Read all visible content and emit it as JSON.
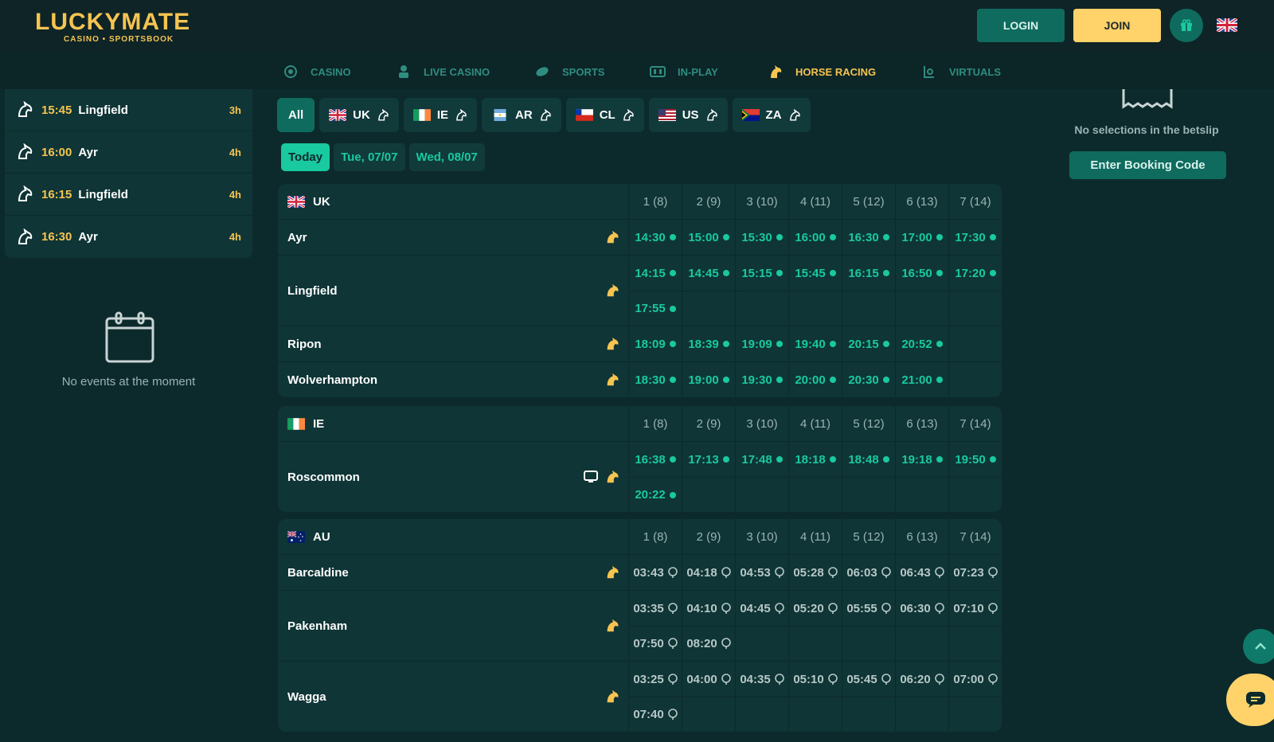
{
  "brand": {
    "name_part1": "LUCKY",
    "name_part2": "MATE",
    "tagline": "CASINO • SPORTSBOOK"
  },
  "header": {
    "login_label": "LOGIN",
    "join_label": "JOIN",
    "gift_icon": "gift-icon",
    "language_flag": "UK"
  },
  "nav": {
    "items": [
      {
        "label": "CASINO",
        "icon": "casino-chip-icon"
      },
      {
        "label": "LIVE CASINO",
        "icon": "dealer-icon"
      },
      {
        "label": "SPORTS",
        "icon": "ball-icon"
      },
      {
        "label": "IN-PLAY",
        "icon": "scoreboard-icon"
      },
      {
        "label": "HORSE RACING",
        "icon": "horse-icon",
        "active": true
      },
      {
        "label": "VIRTUALS",
        "icon": "virtuals-icon"
      }
    ]
  },
  "upcoming": [
    {
      "time": "15:45",
      "track": "Lingfield",
      "eta": "3h"
    },
    {
      "time": "16:00",
      "track": "Ayr",
      "eta": "4h"
    },
    {
      "time": "16:15",
      "track": "Lingfield",
      "eta": "4h"
    },
    {
      "time": "16:30",
      "track": "Ayr",
      "eta": "4h"
    }
  ],
  "no_events": "No events at the moment",
  "country_filters": {
    "all": "All",
    "countries": [
      "UK",
      "IE",
      "AR",
      "CL",
      "US",
      "ZA"
    ]
  },
  "date_filters": [
    "Today",
    "Tue, 07/07",
    "Wed, 08/07"
  ],
  "columns": [
    "1 (8)",
    "2 (9)",
    "3 (10)",
    "4 (11)",
    "5 (12)",
    "6 (13)",
    "7 (14)"
  ],
  "sections": {
    "uk": {
      "country": "UK",
      "meetings": [
        {
          "track": "Ayr",
          "races": [
            "14:30",
            "15:00",
            "15:30",
            "16:00",
            "16:30",
            "17:00",
            "17:30"
          ]
        },
        {
          "track": "Lingfield",
          "races": [
            "14:15",
            "14:45",
            "15:15",
            "15:45",
            "16:15",
            "16:50",
            "17:20",
            "17:55"
          ]
        },
        {
          "track": "Ripon",
          "races": [
            "18:09",
            "18:39",
            "19:09",
            "19:40",
            "20:15",
            "20:52"
          ]
        },
        {
          "track": "Wolverhampton",
          "races": [
            "18:30",
            "19:00",
            "19:30",
            "20:00",
            "20:30",
            "21:00"
          ]
        }
      ]
    },
    "ie": {
      "country": "IE",
      "meetings": [
        {
          "track": "Roscommon",
          "races": [
            "16:38",
            "17:13",
            "17:48",
            "18:18",
            "18:48",
            "19:18",
            "19:50",
            "20:22"
          ]
        }
      ]
    },
    "au": {
      "country": "AU",
      "meetings": [
        {
          "track": "Barcaldine",
          "races": [
            "03:43",
            "04:18",
            "04:53",
            "05:28",
            "06:03",
            "06:43",
            "07:23"
          ]
        },
        {
          "track": "Pakenham",
          "races": [
            "03:35",
            "04:10",
            "04:45",
            "05:20",
            "05:55",
            "06:30",
            "07:10",
            "07:50",
            "08:20"
          ]
        },
        {
          "track": "Wagga",
          "races": [
            "03:25",
            "04:00",
            "04:35",
            "05:10",
            "05:45",
            "06:20",
            "07:00",
            "07:40"
          ]
        }
      ]
    }
  },
  "betslip": {
    "empty_text": "No selections in the betslip",
    "booking_label": "Enter Booking Code"
  },
  "colors": {
    "accent": "#19c9a0",
    "gold": "#f5c451",
    "background": "#0c2a2c",
    "panel": "#0f3536"
  }
}
